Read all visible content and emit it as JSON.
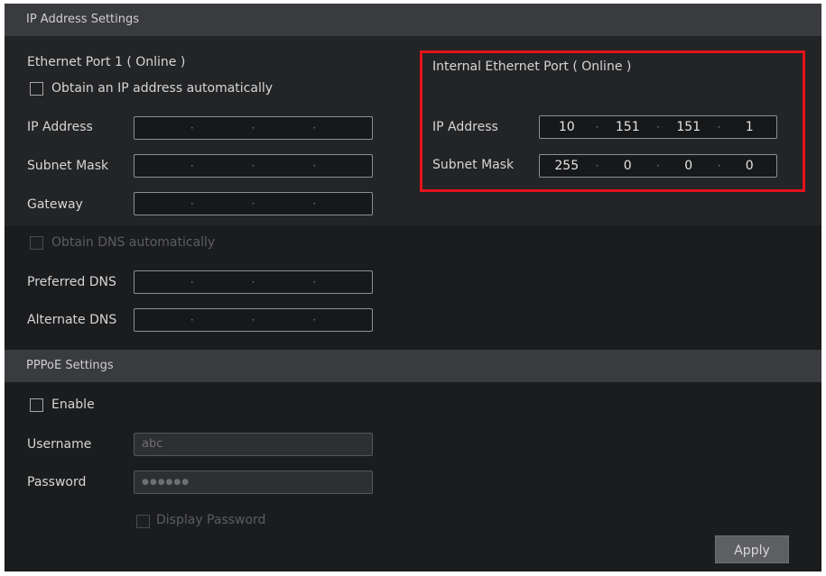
{
  "ip_settings": {
    "header": "IP Address Settings",
    "eth1": {
      "title": "Ethernet Port 1 ( Online )",
      "obtain_auto_label": "Obtain an IP address automatically",
      "ip_label": "IP Address",
      "subnet_label": "Subnet Mask",
      "gateway_label": "Gateway",
      "ip_address": [
        "",
        "",
        "",
        ""
      ],
      "subnet_mask": [
        "",
        "",
        "",
        ""
      ],
      "gateway": [
        "",
        "",
        "",
        ""
      ]
    },
    "internal": {
      "title": "Internal Ethernet Port ( Online )",
      "ip_label": "IP Address",
      "subnet_label": "Subnet Mask",
      "ip_address": [
        "10",
        "151",
        "151",
        "1"
      ],
      "subnet_mask": [
        "255",
        "0",
        "0",
        "0"
      ]
    },
    "dns": {
      "obtain_auto_label": "Obtain DNS automatically",
      "preferred_label": "Preferred DNS",
      "alternate_label": "Alternate DNS",
      "preferred": [
        "",
        "",
        "",
        ""
      ],
      "alternate": [
        "",
        "",
        "",
        ""
      ]
    }
  },
  "pppoe": {
    "header": "PPPoE Settings",
    "enable_label": "Enable",
    "username_label": "Username",
    "username_value": "abc",
    "password_label": "Password",
    "password_value": "●●●●●●",
    "display_password_label": "Display Password"
  },
  "apply_label": "Apply",
  "colors": {
    "highlight": "#e3131c",
    "header_bg": "#3a3b3e",
    "body_bg": "#232426"
  }
}
